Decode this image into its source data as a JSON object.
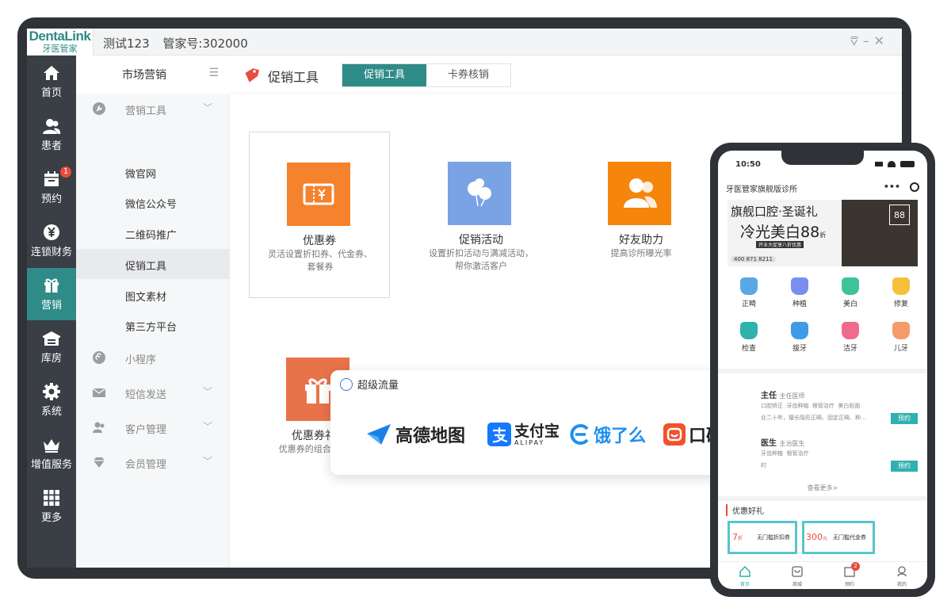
{
  "titlebar": {
    "logo_main": "DentaLink",
    "logo_sub": "牙医管家",
    "user": "测试123",
    "manager_id": "管家号:302000",
    "controls": "⩢–✕"
  },
  "nav": {
    "items": [
      {
        "label": "首页",
        "icon": "home-icon"
      },
      {
        "label": "患者",
        "icon": "patients-icon"
      },
      {
        "label": "预约",
        "icon": "calendar-icon",
        "badge": "1"
      },
      {
        "label": "连锁财务",
        "icon": "yuan-icon"
      },
      {
        "label": "营销",
        "icon": "gift-icon"
      },
      {
        "label": "库房",
        "icon": "warehouse-icon"
      },
      {
        "label": "系统",
        "icon": "gear-icon"
      },
      {
        "label": "增值服务",
        "icon": "crown-icon"
      },
      {
        "label": "更多",
        "icon": "grid-icon"
      }
    ]
  },
  "menu": {
    "title": "市场营销",
    "collapse_icon": "☰",
    "group_marketing_tools": "营销工具",
    "subitems": [
      "微官网",
      "微信公众号",
      "二维码推广",
      "促销工具",
      "图文素材",
      "第三方平台"
    ],
    "mini_program": "小程序",
    "sms": "短信发送",
    "customers": "客户管理",
    "members": "会员管理"
  },
  "content": {
    "title": "促销工具",
    "tabs": [
      "促销工具",
      "卡券核销"
    ],
    "cards": [
      {
        "name": "优惠券",
        "desc": "灵活设置折扣券、代金券、套餐券",
        "color": "#f5822d"
      },
      {
        "name": "促销活动",
        "desc": "设置折扣活动与满减活动，帮你激活客户",
        "color": "#7aa3e5"
      },
      {
        "name": "好友助力",
        "desc": "提高诊所曝光率",
        "color": "#f5860b"
      },
      {
        "name": "优惠券礼包",
        "desc": "优惠券的组合营销,一",
        "color": "#e97349"
      }
    ]
  },
  "traffic": {
    "title": "超级流量",
    "brands": [
      "高德地图",
      "支付宝",
      "ALIPAY",
      "饿了么",
      "口碑"
    ]
  },
  "phone": {
    "time": "10:50",
    "clinic": "牙医管家旗舰版诊所",
    "banner_title": "旗舰口腔·圣诞礼",
    "banner_sub": "冷光美白88",
    "banner_unit": "折",
    "banner_tag": "开业大促享八折优惠",
    "banner_phone": "400 871 8211",
    "banner_badge": "88",
    "categories": [
      "正畸",
      "种植",
      "美白",
      "修复",
      "检查",
      "拔牙",
      "洁牙",
      "儿牙"
    ],
    "doc1_name": "主任",
    "doc1_title": "主任医师",
    "doc1_tags": [
      "口腔矫正",
      "牙齿种植",
      "根管治疗",
      "美白贴面"
    ],
    "doc1_desc": "业二十年，擅长隐形正畸、固定正畸、种...",
    "doc2_name": "医生",
    "doc2_title": "主治医生",
    "doc2_tags": [
      "牙齿种植",
      "根管治疗"
    ],
    "doc2_desc": "的",
    "book_label": "预约",
    "more": "查看更多>",
    "coupon_section": "优惠好礼",
    "coupons": [
      {
        "amount": "7",
        "unit": "折",
        "name": "无门槛折扣券"
      },
      {
        "amount": "300",
        "unit": "元",
        "name": "无门槛代金券"
      }
    ],
    "tabbar": [
      "首页",
      "商城",
      "预约",
      "我的"
    ],
    "tab_badge": "2"
  }
}
